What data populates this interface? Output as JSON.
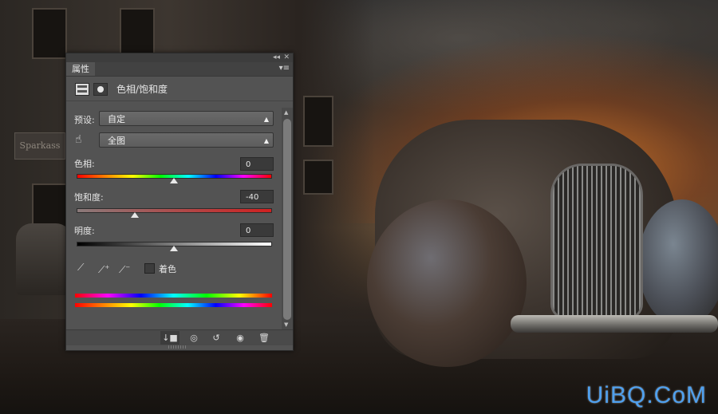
{
  "panel": {
    "tab_label": "属性",
    "collapse_glyph": "◂◂",
    "close_glyph": "✕",
    "menu_glyph": "▾≡",
    "title": "色相/饱和度"
  },
  "preset": {
    "label": "预设:",
    "value": "自定"
  },
  "channel": {
    "value": "全图"
  },
  "hue": {
    "label": "色相:",
    "value": "0",
    "position": 0.5
  },
  "saturation": {
    "label": "饱和度:",
    "value": "-40",
    "position": 0.3
  },
  "lightness": {
    "label": "明度:",
    "value": "0",
    "position": 0.5
  },
  "colorize": {
    "label": "着色",
    "checked": false
  },
  "icons": {
    "eyedropper": "eyedropper-icon",
    "eyedropper_plus": "eyedropper-plus-icon",
    "eyedropper_minus": "eyedropper-minus-icon",
    "hand": "targeted-adjustment-icon",
    "clip": "clip-to-layer-icon",
    "view_previous": "view-previous-icon",
    "reset": "reset-icon",
    "visibility": "eye-icon",
    "delete": "trash-icon"
  },
  "background": {
    "sign_text": "Sparkass",
    "watermark": "UiBQ.CoM"
  },
  "colors": {
    "panel_bg": "#535353",
    "watermark": "#4fa0ee"
  }
}
